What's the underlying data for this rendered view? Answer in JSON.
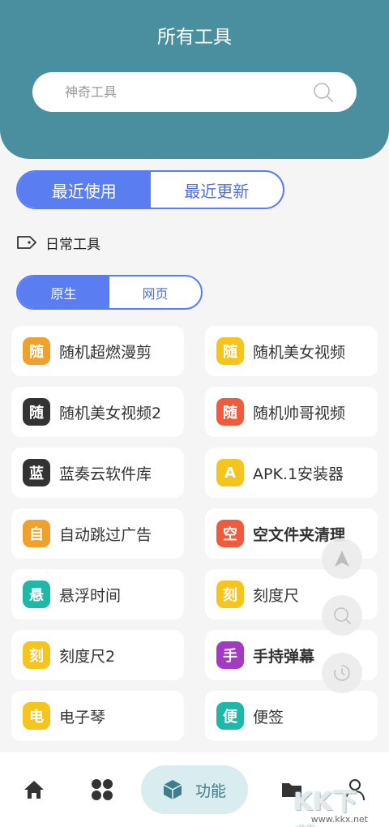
{
  "header": {
    "title": "所有工具",
    "search_placeholder": "神奇工具"
  },
  "main_tabs": [
    {
      "label": "最近使用",
      "active": true
    },
    {
      "label": "最近更新",
      "active": false
    }
  ],
  "category": {
    "label": "日常工具"
  },
  "sub_tabs": [
    {
      "label": "原生",
      "active": true
    },
    {
      "label": "网页",
      "active": false
    }
  ],
  "tools": [
    {
      "badge": "随",
      "badge_color": "#f0a02c",
      "name": "随机超燃漫剪"
    },
    {
      "badge": "随",
      "badge_color": "#f5c51d",
      "name": "随机美女视频"
    },
    {
      "badge": "随",
      "badge_color": "#333333",
      "name": "随机美女视频2"
    },
    {
      "badge": "随",
      "badge_color": "#f05b3d",
      "name": "随机帅哥视频"
    },
    {
      "badge": "蓝",
      "badge_color": "#333333",
      "name": "蓝奏云软件库"
    },
    {
      "badge": "A",
      "badge_color": "#f5c51d",
      "name": "APK.1安装器"
    },
    {
      "badge": "自",
      "badge_color": "#f0a02c",
      "name": "自动跳过广告"
    },
    {
      "badge": "空",
      "badge_color": "#f05b3d",
      "name": "空文件夹清理"
    },
    {
      "badge": "悬",
      "badge_color": "#1fb8a8",
      "name": "悬浮时间"
    },
    {
      "badge": "刻",
      "badge_color": "#f5c51d",
      "name": "刻度尺"
    },
    {
      "badge": "刻",
      "badge_color": "#f5c51d",
      "name": "刻度尺2"
    },
    {
      "badge": "手",
      "badge_color": "#a23bc0",
      "name": "手持弹幕"
    },
    {
      "badge": "电",
      "badge_color": "#f5c51d",
      "name": "电子琴"
    },
    {
      "badge": "便",
      "badge_color": "#1fb8a8",
      "name": "便签"
    }
  ],
  "bottom_nav": {
    "active_label": "功能",
    "items": [
      "home-icon",
      "grid-icon",
      "cube-icon",
      "folder-icon",
      "user-icon"
    ]
  },
  "watermark": {
    "big": "KK下载",
    "small": "www.kkx.net"
  }
}
